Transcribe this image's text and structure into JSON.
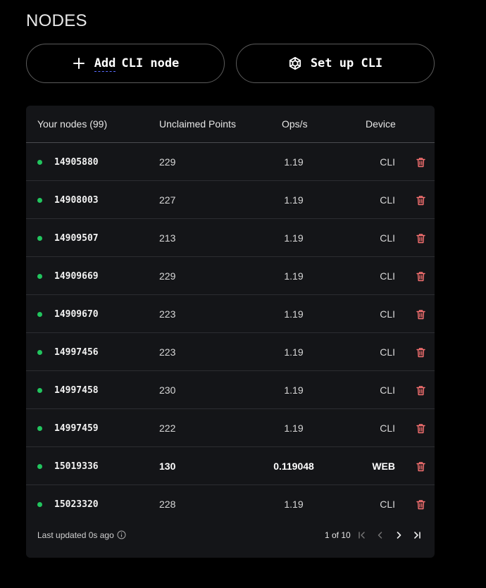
{
  "page": {
    "title": "NODES"
  },
  "actions": {
    "add_label_a": "Add",
    "add_label_b": "CLI node",
    "setup_label": "Set up CLI"
  },
  "table": {
    "headers": {
      "nodes": "Your nodes (99)",
      "points": "Unclaimed Points",
      "ops": "Ops/s",
      "device": "Device"
    },
    "rows": [
      {
        "id": "14905880",
        "points": "229",
        "ops": "1.19",
        "device": "CLI"
      },
      {
        "id": "14908003",
        "points": "227",
        "ops": "1.19",
        "device": "CLI"
      },
      {
        "id": "14909507",
        "points": "213",
        "ops": "1.19",
        "device": "CLI"
      },
      {
        "id": "14909669",
        "points": "229",
        "ops": "1.19",
        "device": "CLI"
      },
      {
        "id": "14909670",
        "points": "223",
        "ops": "1.19",
        "device": "CLI"
      },
      {
        "id": "14997456",
        "points": "223",
        "ops": "1.19",
        "device": "CLI"
      },
      {
        "id": "14997458",
        "points": "230",
        "ops": "1.19",
        "device": "CLI"
      },
      {
        "id": "14997459",
        "points": "222",
        "ops": "1.19",
        "device": "CLI"
      },
      {
        "id": "15019336",
        "points": "130",
        "ops": "0.119048",
        "device": "WEB",
        "highlight": true
      },
      {
        "id": "15023320",
        "points": "228",
        "ops": "1.19",
        "device": "CLI"
      }
    ]
  },
  "footer": {
    "last_updated": "Last updated 0s ago",
    "page_indicator": "1 of 10"
  },
  "colors": {
    "status_online": "#22c55e",
    "trash": "#f87171",
    "panel_bg": "#141518"
  },
  "icons": {
    "add": "plus-icon",
    "setup": "cube-icon",
    "delete": "trash-icon",
    "info": "info-icon",
    "first": "first-page-icon",
    "prev": "chevron-left-icon",
    "next": "chevron-right-icon",
    "last": "last-page-icon"
  }
}
